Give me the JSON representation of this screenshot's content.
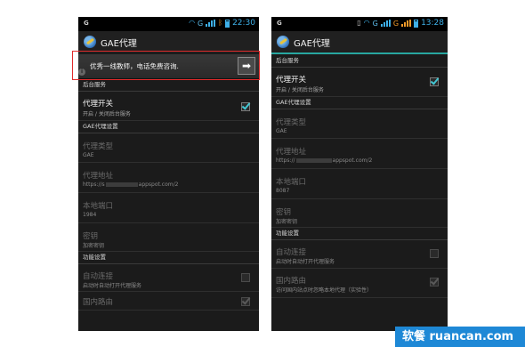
{
  "left_phone": {
    "status": {
      "carrier": "G",
      "time": "22:30",
      "network": "G"
    },
    "app_title": "GAE代理",
    "ad": {
      "text": "优秀一线教师，电话免费咨询.",
      "arrow": "➡",
      "info": "i"
    },
    "categories": {
      "background": "后台服务",
      "gae": "GAE代理设置",
      "features": "功能设置"
    },
    "proxy_switch": {
      "title": "代理开关",
      "summary": "开启 / 关闭后台服务",
      "checked": true
    },
    "proxy_type": {
      "title": "代理类型",
      "summary": "GAE"
    },
    "proxy_address": {
      "title": "代理地址",
      "summary_prefix": "https://s",
      "summary_suffix": "appspot.com/2"
    },
    "local_port": {
      "title": "本地端口",
      "summary": "1984"
    },
    "key": {
      "title": "密钥",
      "summary": "加密密钥"
    },
    "auto_connect": {
      "title": "自动连接",
      "summary": "启动时自动打开代理服务"
    },
    "domestic_route": {
      "title": "国内路由"
    }
  },
  "right_phone": {
    "status": {
      "carrier": "G",
      "time": "13:28",
      "network": "G"
    },
    "app_title": "GAE代理",
    "categories": {
      "background": "后台服务",
      "gae": "GAE代理设置",
      "features": "功能设置"
    },
    "proxy_switch": {
      "title": "代理开关",
      "summary": "开启 / 关闭后台服务",
      "checked": true
    },
    "proxy_type": {
      "title": "代理类型",
      "summary": "GAE"
    },
    "proxy_address": {
      "title": "代理地址",
      "summary_prefix": "https://",
      "summary_suffix": "appspot.com/2"
    },
    "local_port": {
      "title": "本地端口",
      "summary": "8087"
    },
    "key": {
      "title": "密钥",
      "summary": "加密密钥"
    },
    "auto_connect": {
      "title": "自动连接",
      "summary": "启动时自动打开代理服务"
    },
    "domestic_route": {
      "title": "国内路由",
      "summary": "访问国内站点时忽略本地代理（实验性）"
    }
  },
  "watermark": "软餐 ruancan.com"
}
